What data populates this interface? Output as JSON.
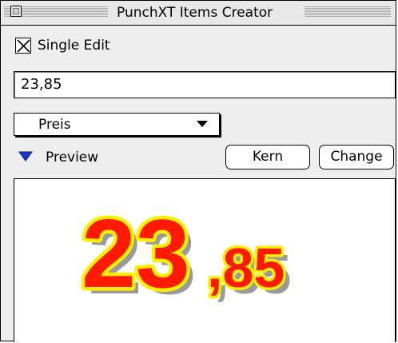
{
  "window": {
    "title": "PunchXT Items Creator"
  },
  "options": {
    "single_edit_label": "Single Edit",
    "single_edit_checked": true
  },
  "price_field": {
    "value": "23,85"
  },
  "field_select": {
    "selected": "Preis"
  },
  "preview": {
    "label": "Preview",
    "expanded": true,
    "main_text": "23",
    "sub_text": ",85",
    "fill_color": "#ff1a00",
    "outline_color": "#ffee00",
    "shadow_color": "#9a9a9a"
  },
  "buttons": {
    "kern_label": "Kern",
    "change_label": "Change"
  },
  "colors": {
    "disclosure_triangle": "#1a3cc8"
  }
}
